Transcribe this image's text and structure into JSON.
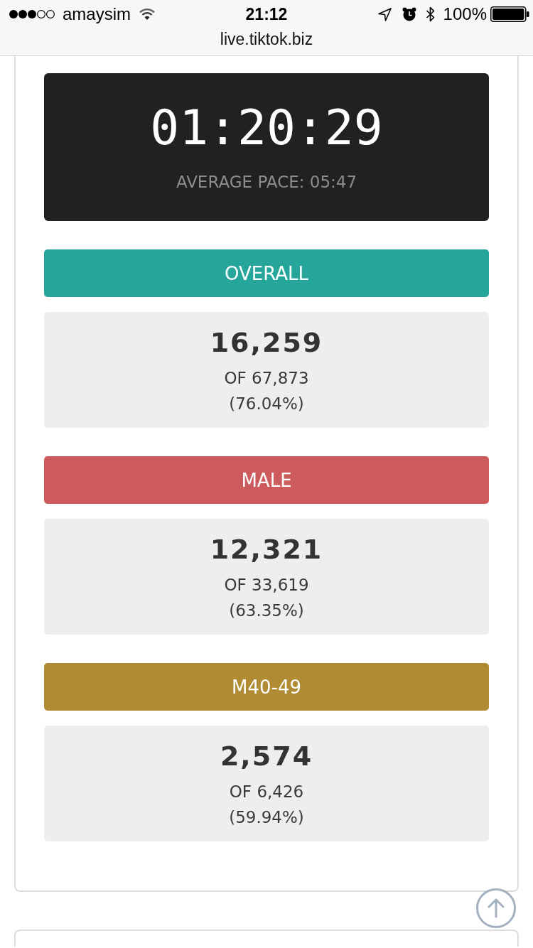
{
  "status_bar": {
    "carrier": "amaysim",
    "time": "21:12",
    "battery": "100%"
  },
  "address_bar": {
    "url": "live.tiktok.biz"
  },
  "timer": {
    "elapsed": "01:20:29",
    "average_pace": "AVERAGE PACE: 05:47"
  },
  "rankings": [
    {
      "label": "OVERALL",
      "color": "#26a69a",
      "rank": "16,259",
      "total": "OF 67,873",
      "percent": "(76.04%)"
    },
    {
      "label": "MALE",
      "color": "#cd5a5c",
      "rank": "12,321",
      "total": "OF 33,619",
      "percent": "(63.35%)"
    },
    {
      "label": "M40-49",
      "color": "#b08b34",
      "rank": "2,574",
      "total": "OF 6,426",
      "percent": "(59.94%)"
    }
  ]
}
